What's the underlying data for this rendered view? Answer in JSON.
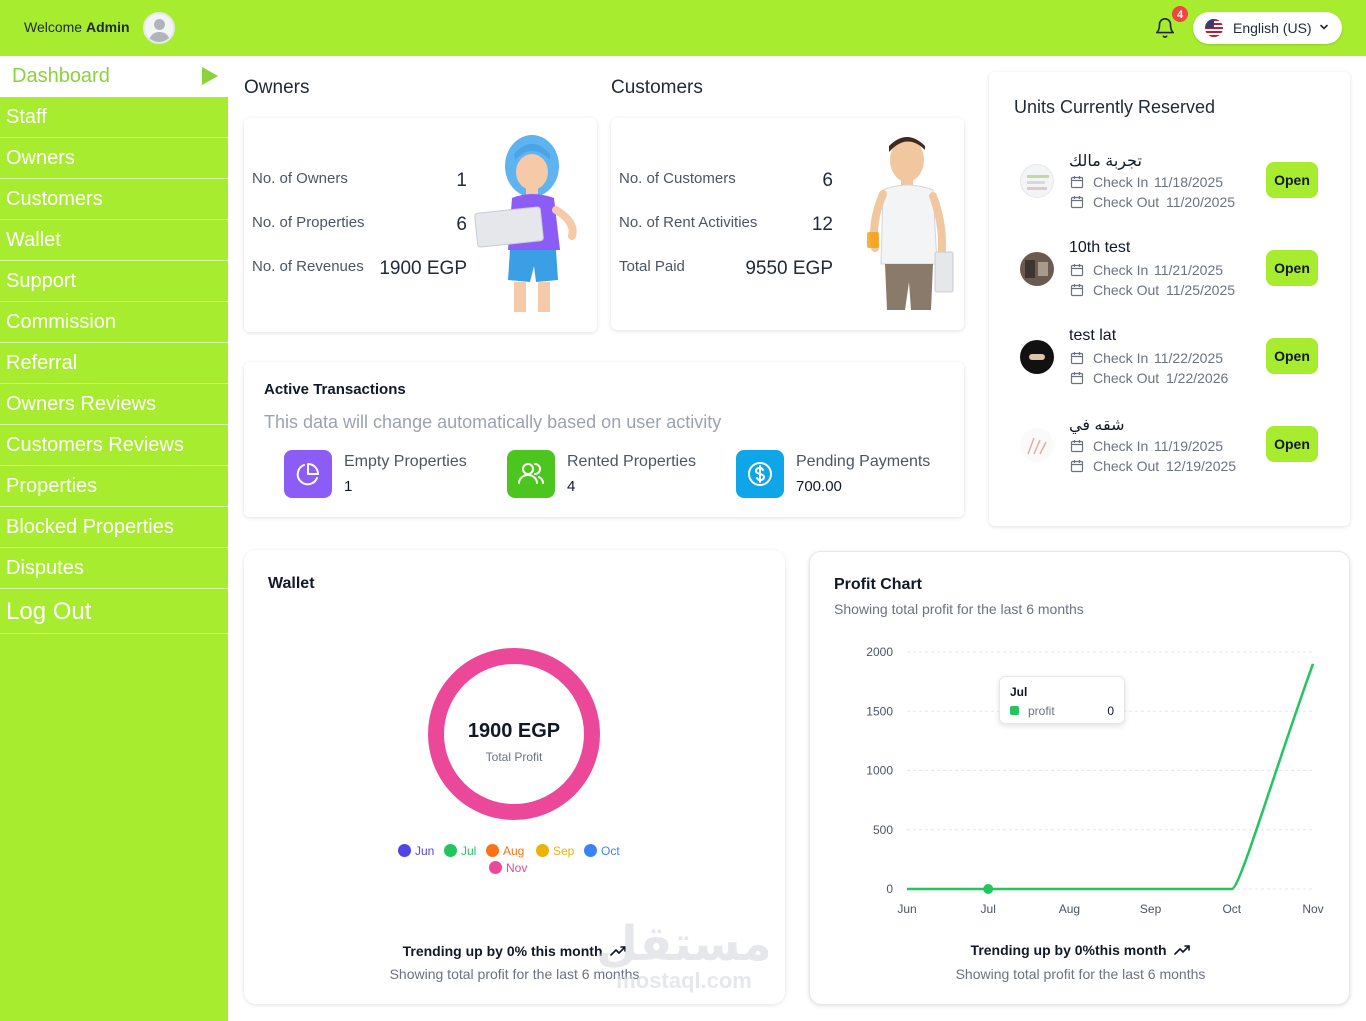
{
  "header": {
    "welcome_prefix": "Welcome",
    "welcome_user": "Admin",
    "notification_count": "4",
    "language": "English (US)"
  },
  "sidebar": {
    "items": [
      {
        "label": "Dashboard"
      },
      {
        "label": "Staff"
      },
      {
        "label": "Owners"
      },
      {
        "label": "Customers"
      },
      {
        "label": "Wallet"
      },
      {
        "label": "Support"
      },
      {
        "label": "Commission"
      },
      {
        "label": "Referral"
      },
      {
        "label": "Owners Reviews"
      },
      {
        "label": "Customers Reviews"
      },
      {
        "label": "Properties"
      },
      {
        "label": "Blocked Properties"
      },
      {
        "label": "Disputes"
      },
      {
        "label": "Log Out"
      }
    ]
  },
  "owners": {
    "title": "Owners",
    "stats": [
      {
        "label": "No. of Owners",
        "value": "1"
      },
      {
        "label": "No. of Properties",
        "value": "6"
      },
      {
        "label": "No. of Revenues",
        "value": "1900 EGP"
      }
    ]
  },
  "customers": {
    "title": "Customers",
    "stats": [
      {
        "label": "No. of Customers",
        "value": "6"
      },
      {
        "label": "No. of Rent Activities",
        "value": "12"
      },
      {
        "label": "Total Paid",
        "value": "9550 EGP"
      }
    ]
  },
  "transactions": {
    "title": "Active Transactions",
    "subtitle": "This data will change automatically based on user activity",
    "items": [
      {
        "label": "Empty Properties",
        "value": "1",
        "color": "#8b5cf6",
        "icon": "pie-chart-icon"
      },
      {
        "label": "Rented Properties",
        "value": "4",
        "color": "#4cc51f",
        "icon": "users-icon"
      },
      {
        "label": "Pending Payments",
        "value": "700.00",
        "color": "#0ea5e9",
        "icon": "dollar-badge-icon"
      }
    ]
  },
  "units": {
    "title": "Units Currently Reserved",
    "check_in_label": "Check In",
    "check_out_label": "Check Out",
    "open_label": "Open",
    "items": [
      {
        "name": "تجربة مالك",
        "check_in": "11/18/2025",
        "check_out": "11/20/2025"
      },
      {
        "name": "10th test",
        "check_in": "11/21/2025",
        "check_out": "11/25/2025"
      },
      {
        "name": "test lat",
        "check_in": "11/22/2025",
        "check_out": "1/22/2026"
      },
      {
        "name": "شقه في",
        "check_in": "11/19/2025",
        "check_out": "12/19/2025"
      }
    ]
  },
  "wallet": {
    "title": "Wallet",
    "center_value": "1900 EGP",
    "center_label": "Total Profit",
    "ring_color": "#ec4899",
    "legend": [
      {
        "label": "Jun",
        "color": "#4f46e5"
      },
      {
        "label": "Jul",
        "color": "#22c55e"
      },
      {
        "label": "Aug",
        "color": "#f97316"
      },
      {
        "label": "Sep",
        "color": "#eab308"
      },
      {
        "label": "Oct",
        "color": "#3b82f6"
      },
      {
        "label": "Nov",
        "color": "#ec4899"
      }
    ],
    "trend": "Trending up by 0% this month",
    "footer": "Showing total profit for the last 6 months"
  },
  "profit": {
    "title": "Profit Chart",
    "subtitle": "Showing total profit for the last 6 months",
    "tooltip": {
      "month": "Jul",
      "series": "profit",
      "value": "0"
    },
    "trend": "Trending up by 0%this month",
    "footer": "Showing total profit for the last 6 months"
  },
  "chart_data": {
    "type": "line",
    "title": "Profit Chart",
    "categories": [
      "Jun",
      "Jul",
      "Aug",
      "Sep",
      "Oct",
      "Nov"
    ],
    "series": [
      {
        "name": "profit",
        "values": [
          0,
          0,
          0,
          0,
          0,
          1900
        ],
        "color": "#22c55e"
      }
    ],
    "yticks": [
      0,
      500,
      1000,
      1500,
      2000
    ],
    "ylim": [
      0,
      2000
    ],
    "grid": true
  },
  "watermark": {
    "text": "مستقل",
    "sub": "mostaql.com"
  }
}
